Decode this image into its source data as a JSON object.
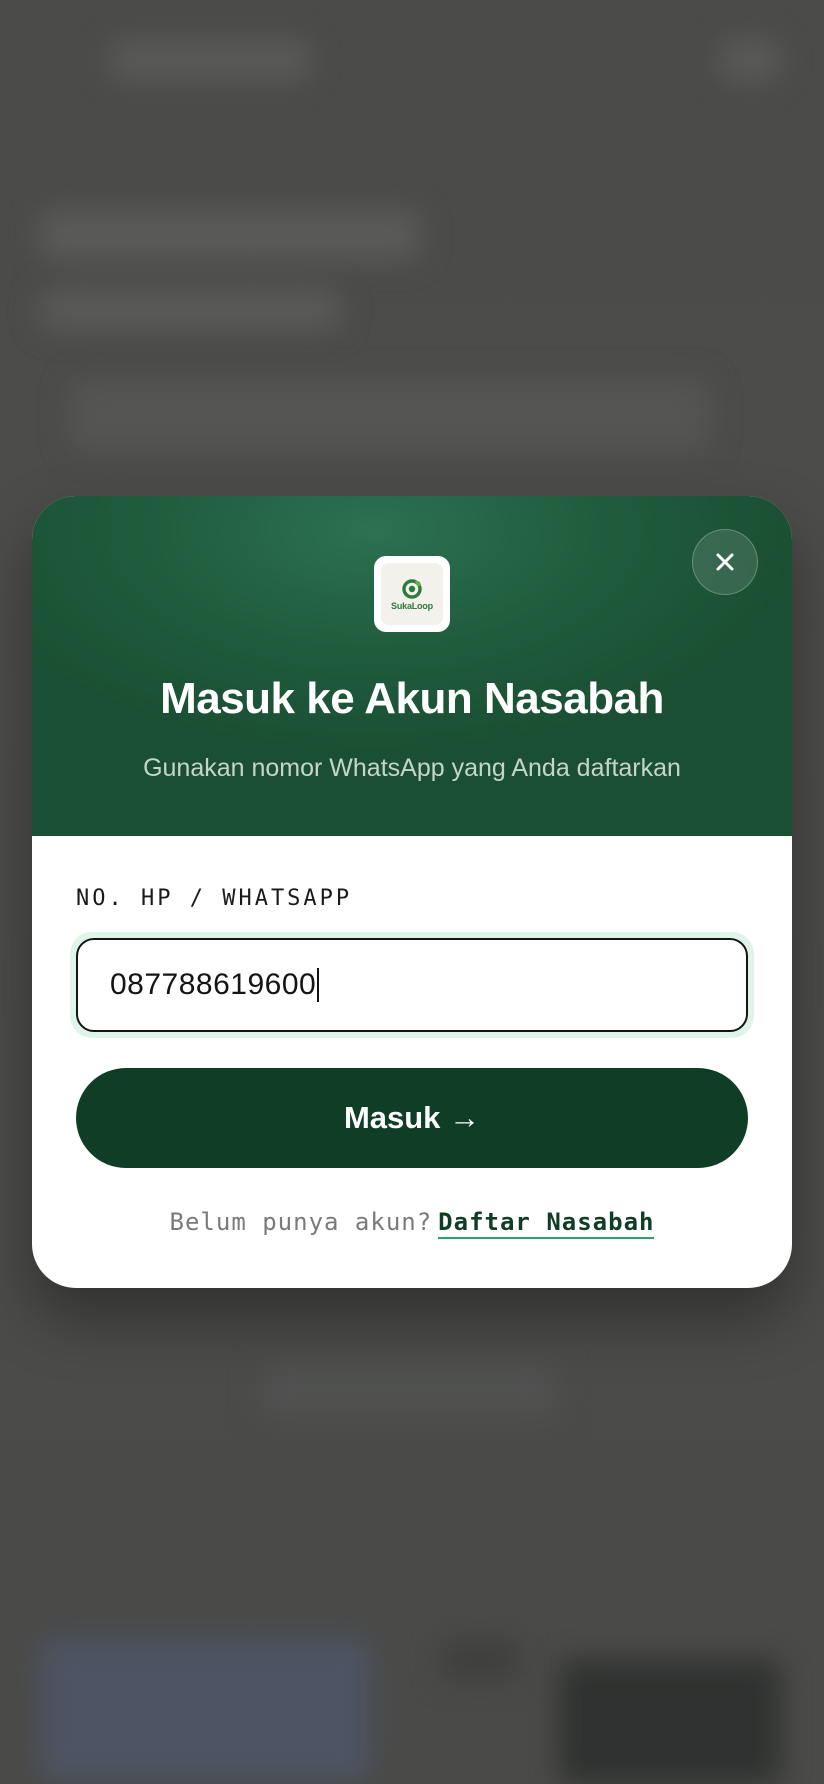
{
  "modal": {
    "logo_text": "SukaLoop",
    "title": "Masuk ke Akun Nasabah",
    "subtitle": "Gunakan nomor WhatsApp yang Anda daftarkan",
    "close_icon": "close-icon"
  },
  "form": {
    "phone_label": "NO. HP / WHATSAPP",
    "phone_value": "087788619600",
    "submit_label": "Masuk →"
  },
  "register": {
    "prompt": "Belum punya akun?",
    "link_label": "Daftar Nasabah"
  },
  "colors": {
    "header_green": "#1f5c3d",
    "button_green": "#0f3d26",
    "link_underline": "#27a36a",
    "overlay": "#4a4b49"
  }
}
